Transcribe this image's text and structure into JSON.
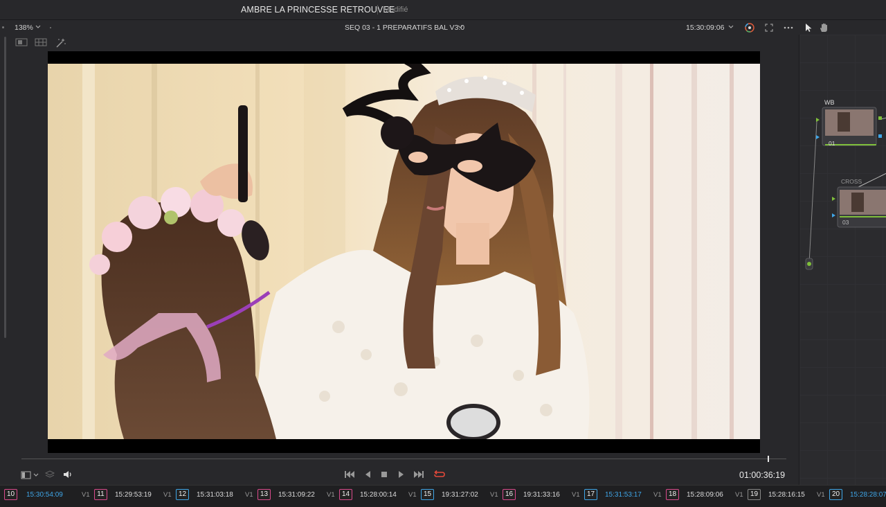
{
  "title_bar": {
    "project": "AMBRE LA PRINCESSE RETROUVEE",
    "status": "Modifié"
  },
  "viewer_toolbar": {
    "zoom": "138%",
    "timeline_name": "SEQ 03 - 1 PREPARATIFS BAL V3.0",
    "source_timecode": "15:30:09:06"
  },
  "transport": {
    "timecode": "01:00:36:19",
    "playhead_position": 0.976
  },
  "node_editor": {
    "nodes": [
      {
        "label": "WB",
        "number": "01"
      },
      {
        "label": "CROSS",
        "number": "03"
      }
    ]
  },
  "clips": [
    {
      "number": "10",
      "timecode": "15:30:54:09",
      "track": "",
      "color": "#d94a8c",
      "active": true
    },
    {
      "number": "11",
      "timecode": "15:29:53:19",
      "track": "V1",
      "color": "#d94a8c",
      "active": false
    },
    {
      "number": "12",
      "timecode": "15:31:03:18",
      "track": "V1",
      "color": "#3fa6e8",
      "active": false
    },
    {
      "number": "13",
      "timecode": "15:31:09:22",
      "track": "V1",
      "color": "#d94a8c",
      "active": false
    },
    {
      "number": "14",
      "timecode": "15:28:00:14",
      "track": "V1",
      "color": "#d94a8c",
      "active": false
    },
    {
      "number": "15",
      "timecode": "19:31:27:02",
      "track": "V1",
      "color": "#3fa6e8",
      "active": false
    },
    {
      "number": "16",
      "timecode": "19:31:33:16",
      "track": "V1",
      "color": "#d94a8c",
      "active": false
    },
    {
      "number": "17",
      "timecode": "15:31:53:17",
      "track": "V1",
      "color": "#3fa6e8",
      "active": true
    },
    {
      "number": "18",
      "timecode": "15:28:09:06",
      "track": "V1",
      "color": "#d94a8c",
      "active": false
    },
    {
      "number": "19",
      "timecode": "15:28:16:15",
      "track": "V1",
      "color": "#888888",
      "active": false
    },
    {
      "number": "20",
      "timecode": "15:28:28:07",
      "track": "V1",
      "color": "#3fa6e8",
      "active": true
    }
  ],
  "icons": {
    "zoom_dropdown": "chevron-down-icon",
    "color_wheel": "color-wheel-icon",
    "fullscreen": "fullscreen-icon",
    "more": "more-icon",
    "pointer": "pointer-icon",
    "hand": "hand-icon",
    "layout_single": "layout-single-icon",
    "layout_grid": "layout-grid-icon",
    "magic_wand": "magic-wand-icon",
    "view_options": "view-options-icon",
    "layers": "layers-icon",
    "audio": "speaker-icon",
    "go_first": "skip-back-icon",
    "play_reverse": "play-reverse-icon",
    "stop": "stop-icon",
    "play": "play-icon",
    "go_last": "skip-forward-icon",
    "loop": "loop-icon"
  }
}
